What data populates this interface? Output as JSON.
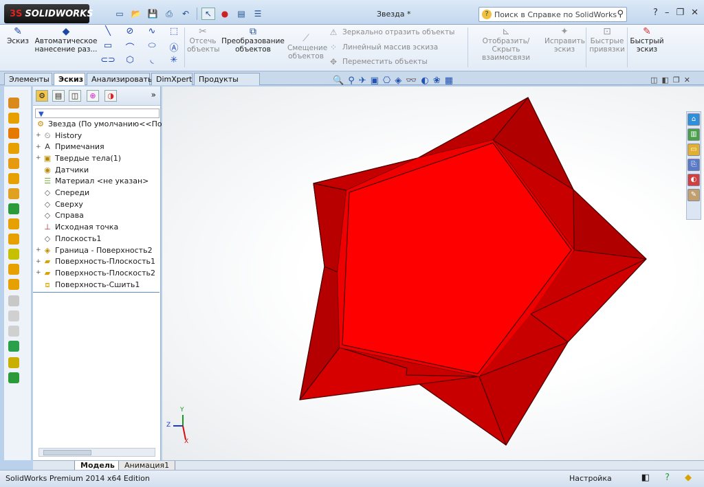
{
  "app": {
    "logo": "SOLIDWORKS",
    "document_title": "Звезда *",
    "search_placeholder": "Поиск в Справке по SolidWorks"
  },
  "ribbon": {
    "sketch": "Эскиз",
    "smart_dimension": "Автоматическое нанесение раз...",
    "trim": "Отсечь объекты",
    "convert": "Преобразование объектов",
    "offset": "Смещение объектов",
    "mirror": "Зеркально отразить объекты",
    "linear_pattern": "Линейный массив эскиза",
    "move": "Переместить объекты",
    "display_relations": "Отобразить/Скрыть взаимосвязи",
    "repair": "Исправить эскиз",
    "quick_snaps": "Быстрые привязки",
    "rapid_sketch": "Быстрый эскиз"
  },
  "tabs": [
    "Элементы",
    "Эскиз",
    "Анализировать",
    "DimXpert",
    "Продукты Office"
  ],
  "active_tab": "Эскиз",
  "tree": {
    "root": "Звезда  (По умолчанию<<По ум",
    "items": [
      {
        "label": "History",
        "icon": "history-icon",
        "expand": "+"
      },
      {
        "label": "Примечания",
        "icon": "annotations-icon",
        "expand": "+"
      },
      {
        "label": "Твердые тела(1)",
        "icon": "solid-bodies-icon",
        "expand": "+"
      },
      {
        "label": "Датчики",
        "icon": "sensors-icon",
        "expand": ""
      },
      {
        "label": "Материал <не указан>",
        "icon": "material-icon",
        "expand": ""
      },
      {
        "label": "Спереди",
        "icon": "plane-icon",
        "expand": ""
      },
      {
        "label": "Сверху",
        "icon": "plane-icon",
        "expand": ""
      },
      {
        "label": "Справа",
        "icon": "plane-icon",
        "expand": ""
      },
      {
        "label": "Исходная точка",
        "icon": "origin-icon",
        "expand": ""
      },
      {
        "label": "Плоскость1",
        "icon": "plane-icon",
        "expand": ""
      },
      {
        "label": "Граница - Поверхность2",
        "icon": "boundary-surface-icon",
        "expand": "+"
      },
      {
        "label": "Поверхность-Плоскость1",
        "icon": "planar-surface-icon",
        "expand": "+"
      },
      {
        "label": "Поверхность-Плоскость2",
        "icon": "planar-surface-icon",
        "expand": "+"
      },
      {
        "label": "Поверхность-Сшить1",
        "icon": "knit-surface-icon",
        "expand": ""
      }
    ]
  },
  "bottom_tabs": [
    "Модель",
    "Анимация1"
  ],
  "status": {
    "left": "SolidWorks Premium 2014 x64 Edition",
    "right": "Настройка"
  },
  "triad": {
    "y": "Y",
    "z": "Z",
    "x": "X"
  },
  "colors": {
    "part": "#e60000",
    "part_dark": "#b30000",
    "part_edge": "#5a0000"
  }
}
